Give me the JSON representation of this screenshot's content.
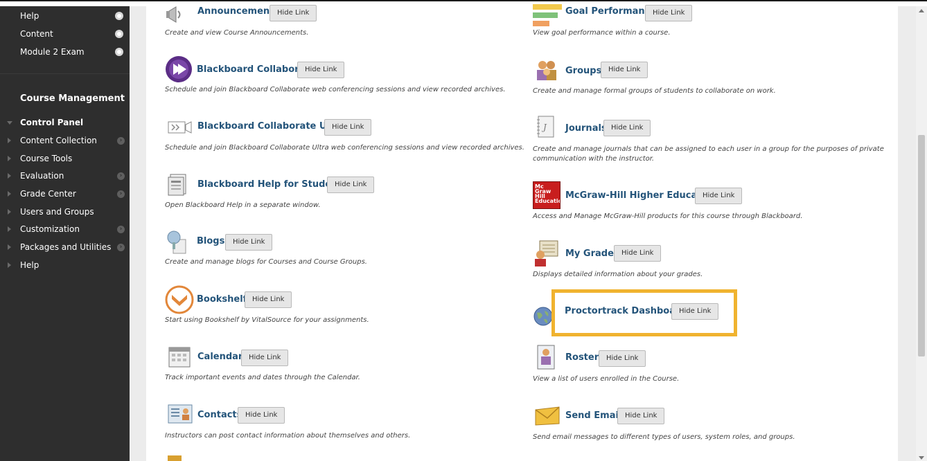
{
  "sidebar": {
    "top_items": [
      {
        "label": "Help"
      },
      {
        "label": "Content"
      },
      {
        "label": "Module 2 Exam"
      }
    ],
    "section_title": "Course Management",
    "control_panel": "Control Panel",
    "cp_items": [
      {
        "label": "Content Collection",
        "has_menu": true
      },
      {
        "label": "Course Tools",
        "has_menu": false
      },
      {
        "label": "Evaluation",
        "has_menu": true
      },
      {
        "label": "Grade Center",
        "has_menu": true
      },
      {
        "label": "Users and Groups",
        "has_menu": false
      },
      {
        "label": "Customization",
        "has_menu": true
      },
      {
        "label": "Packages and Utilities",
        "has_menu": true
      },
      {
        "label": "Help",
        "has_menu": false
      }
    ]
  },
  "hide_label": "Hide Link",
  "tools_left": [
    {
      "name": "Announcements",
      "desc": "Create and view Course Announcements.",
      "icon": "megaphone-icon"
    },
    {
      "name": "Blackboard Collaborate",
      "desc": "Schedule and join Blackboard Collaborate web conferencing sessions and view recorded archives.",
      "icon": "collaborate-icon"
    },
    {
      "name": "Blackboard Collaborate Ultra",
      "desc": "Schedule and join Blackboard Collaborate Ultra web conferencing sessions and view recorded archives.",
      "icon": "collaborate-ultra-icon"
    },
    {
      "name": "Blackboard Help for Students",
      "desc": "Open Blackboard Help in a separate window.",
      "icon": "help-document-icon"
    },
    {
      "name": "Blogs",
      "desc": "Create and manage blogs for Courses and Course Groups.",
      "icon": "blog-icon"
    },
    {
      "name": "Bookshelf",
      "desc": "Start using Bookshelf by VitalSource for your assignments.",
      "icon": "bookshelf-icon"
    },
    {
      "name": "Calendar",
      "desc": "Track important events and dates through the Calendar.",
      "icon": "calendar-icon"
    },
    {
      "name": "Contacts",
      "desc": "Instructors can post contact information about themselves and others.",
      "icon": "contacts-icon"
    }
  ],
  "tools_right": [
    {
      "name": "Goal Performance",
      "desc": "View goal performance within a course.",
      "icon": "goal-chart-icon"
    },
    {
      "name": "Groups",
      "desc": "Create and manage formal groups of students to collaborate on work.",
      "icon": "groups-icon"
    },
    {
      "name": "Journals",
      "desc": "Create and manage journals that can be assigned to each user in a group for the purposes of private communication with the instructor.",
      "icon": "journal-icon"
    },
    {
      "name": "McGraw-Hill Higher Education",
      "desc": "Access and Manage McGraw-Hill products for this course through Blackboard.",
      "icon": "mcgraw-hill-logo-icon",
      "logo_text": "Mc Graw Hill Education"
    },
    {
      "name": "My Grades",
      "desc": "Displays detailed information about your grades.",
      "icon": "grades-icon"
    },
    {
      "name": "Proctortrack Dashboard",
      "desc": "",
      "icon": "globe-icon"
    },
    {
      "name": "Roster",
      "desc": "View a list of users enrolled in the Course.",
      "icon": "roster-icon"
    },
    {
      "name": "Send Email",
      "desc": "Send email messages to different types of users, system roles, and groups.",
      "icon": "envelope-icon"
    }
  ],
  "colors": {
    "sidebar_bg": "#2e2e2e",
    "link": "#24547a",
    "highlight": "#f0b32f"
  }
}
